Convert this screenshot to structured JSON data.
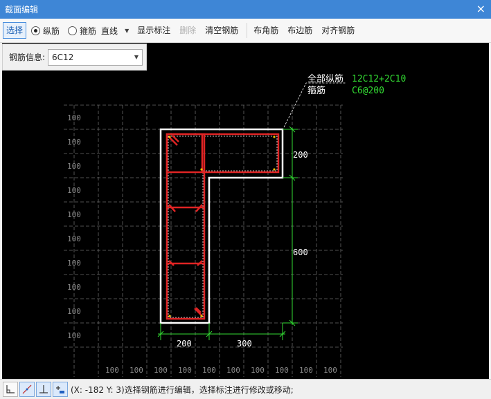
{
  "window": {
    "title": "截面编辑",
    "close_glyph": "×"
  },
  "toolbar": {
    "select": "选择",
    "longitudinal": "纵筋",
    "stirrup": "箍筋",
    "line_mode": "直线",
    "show_annotation": "显示标注",
    "delete": "删除",
    "clear_rebar": "清空钢筋",
    "corner_rebar": "布角筋",
    "edge_rebar": "布边筋",
    "align_rebar": "对齐钢筋"
  },
  "rebar_info": {
    "label": "钢筋信息:",
    "value": "6C12"
  },
  "drawing": {
    "all_long_label": "全部纵筋",
    "all_long_value": "12C12+2C10",
    "stirrup_label": "箍筋",
    "stirrup_value": "C6@200",
    "dim_top_height": "200",
    "dim_total_height": "600",
    "dim_bottom_left": "200",
    "dim_bottom_right": "300",
    "grid_label": "100",
    "colors": {
      "outline": "#ffffff",
      "rebar": "#e02424",
      "dimension": "#33dd33",
      "grid": "#6a6a6a",
      "text": "#ffffff"
    }
  },
  "status": {
    "text": "(X: -182 Y: 3)选择钢筋进行编辑，选择标注进行修改或移动;"
  }
}
